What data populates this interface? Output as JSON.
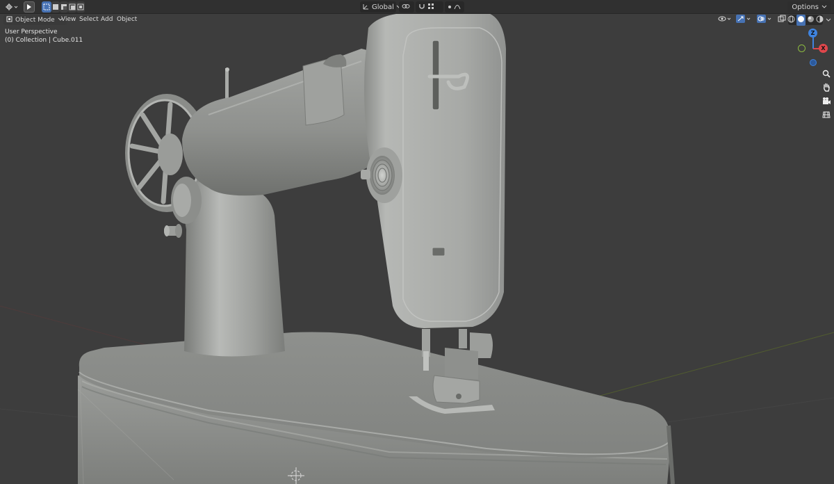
{
  "header": {
    "options_label": "Options",
    "orientation_label": "Global"
  },
  "viewport": {
    "mode_label": "Object Mode",
    "menus": [
      "View",
      "Select",
      "Add",
      "Object"
    ],
    "perspective_label": "User Perspective",
    "collection_label": "(0) Collection | Cube.011"
  },
  "gizmo": {
    "z_label": "Z",
    "x_label": "X",
    "colors": {
      "x": "#e0474c",
      "y": "#8bb940",
      "z": "#3f84e0"
    }
  },
  "icons": {
    "editor_type": "cursor-icon",
    "tool": "select-box-icon",
    "zoom": "zoom-icon",
    "pan": "hand-icon",
    "camera": "camera-icon",
    "grid": "grid-icon"
  }
}
